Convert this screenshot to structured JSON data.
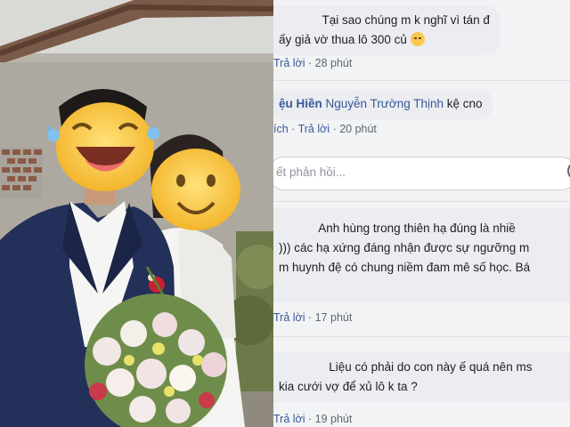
{
  "comments": [
    {
      "author": "",
      "text_lines": [
        "Tại sao chúng m k nghĩ vì tán đ",
        "ấy giả vờ thua lô 300 củ"
      ],
      "emoji": "pensive-face-emoji",
      "reply_label": "Trả lời",
      "time": "28 phút"
    },
    {
      "author": "ệu Hiền",
      "mention": "Nguyễn Trường Thịnh",
      "text": "kệ cno",
      "like_label": "ích",
      "reply_label": "Trả lời",
      "time": "20 phút"
    },
    {
      "author": "",
      "text_lines": [
        "Anh hùng trong thiên hạ đúng là nhiề",
        "))) các hạ xứng đáng nhận được sự ngưỡng m",
        "m huynh đệ có chung niềm đam mê số học. Bá"
      ],
      "reply_label": "Trả lời",
      "time": "17 phút"
    },
    {
      "author": "",
      "text_lines": [
        "Liệu có phải do con này ế quá nên ms",
        "kia cưới vợ để xủ lô k ta ?"
      ],
      "reply_label": "Trả lời",
      "time": "19 phút"
    }
  ],
  "reply_box": {
    "placeholder": "ết phản hồi..."
  },
  "colors": {
    "link": "#385898",
    "bubble": "#ebedf0",
    "panel_bg": "#f2f3f5",
    "meta": "#606770"
  }
}
